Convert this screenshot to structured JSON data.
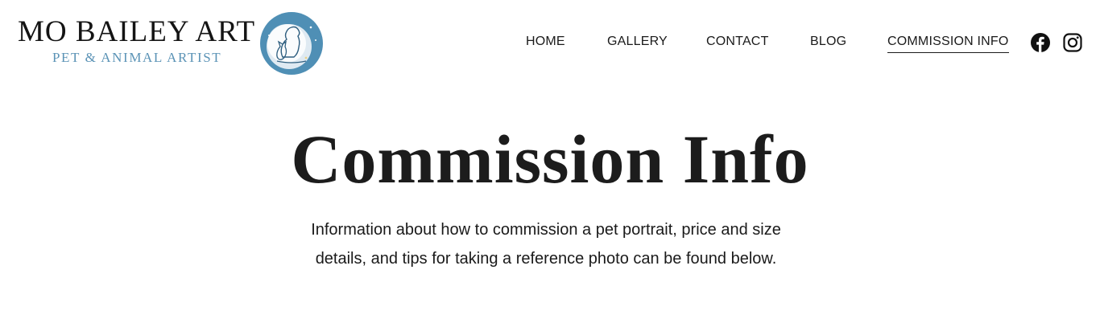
{
  "brand": {
    "title": "MO BAILEY ART",
    "subtitle": "PET & ANIMAL ARTIST",
    "logo_icon": "dog-and-cat-moon-logo",
    "logo_color": "#4f8fb5"
  },
  "nav": {
    "items": [
      {
        "label": "HOME"
      },
      {
        "label": "GALLERY"
      },
      {
        "label": "CONTACT"
      },
      {
        "label": "BLOG"
      },
      {
        "label": "COMMISSION INFO",
        "active": true
      }
    ]
  },
  "social": {
    "facebook_icon": "facebook-icon",
    "instagram_icon": "instagram-icon"
  },
  "hero": {
    "title": "Commission Info",
    "text": "Information about how to commission a pet portrait, price and size details, and tips for taking a reference photo can be found below."
  }
}
